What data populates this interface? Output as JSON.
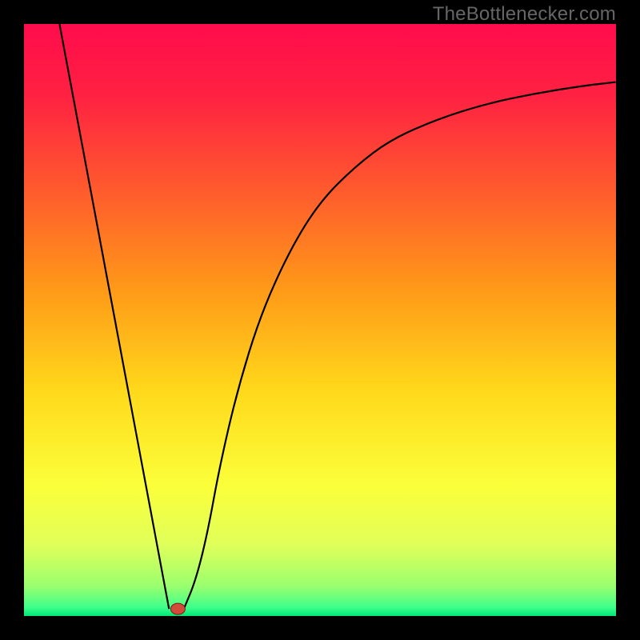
{
  "watermark": "TheBottlenecker.com",
  "colors": {
    "gradient": [
      {
        "stop": 0.0,
        "color": "#ff0c4c"
      },
      {
        "stop": 0.12,
        "color": "#ff2142"
      },
      {
        "stop": 0.28,
        "color": "#ff5a2d"
      },
      {
        "stop": 0.45,
        "color": "#ff9a18"
      },
      {
        "stop": 0.62,
        "color": "#ffd91b"
      },
      {
        "stop": 0.78,
        "color": "#fbff3a"
      },
      {
        "stop": 0.88,
        "color": "#e0ff5a"
      },
      {
        "stop": 0.95,
        "color": "#99ff6e"
      },
      {
        "stop": 0.985,
        "color": "#40ff8a"
      },
      {
        "stop": 1.0,
        "color": "#00e878"
      }
    ],
    "curve": "#000000",
    "marker_fill": "#d24a3a",
    "marker_stroke": "#7a1e12",
    "frame": "#000000"
  },
  "chart_data": {
    "type": "line",
    "title": "",
    "xlabel": "",
    "ylabel": "",
    "xlim": [
      0,
      100
    ],
    "ylim": [
      0,
      100
    ],
    "series": [
      {
        "name": "left-line",
        "x": [
          6,
          24.5
        ],
        "values": [
          100,
          1.2
        ]
      },
      {
        "name": "right-curve",
        "x": [
          27,
          29,
          31,
          33,
          36,
          40,
          45,
          50,
          56,
          62,
          70,
          78,
          86,
          94,
          100
        ],
        "values": [
          1.2,
          6,
          14,
          25,
          38,
          51,
          62,
          70,
          76,
          80.5,
          84,
          86.5,
          88.2,
          89.5,
          90.2
        ]
      }
    ],
    "marker": {
      "x": 26,
      "y": 1.2
    }
  }
}
